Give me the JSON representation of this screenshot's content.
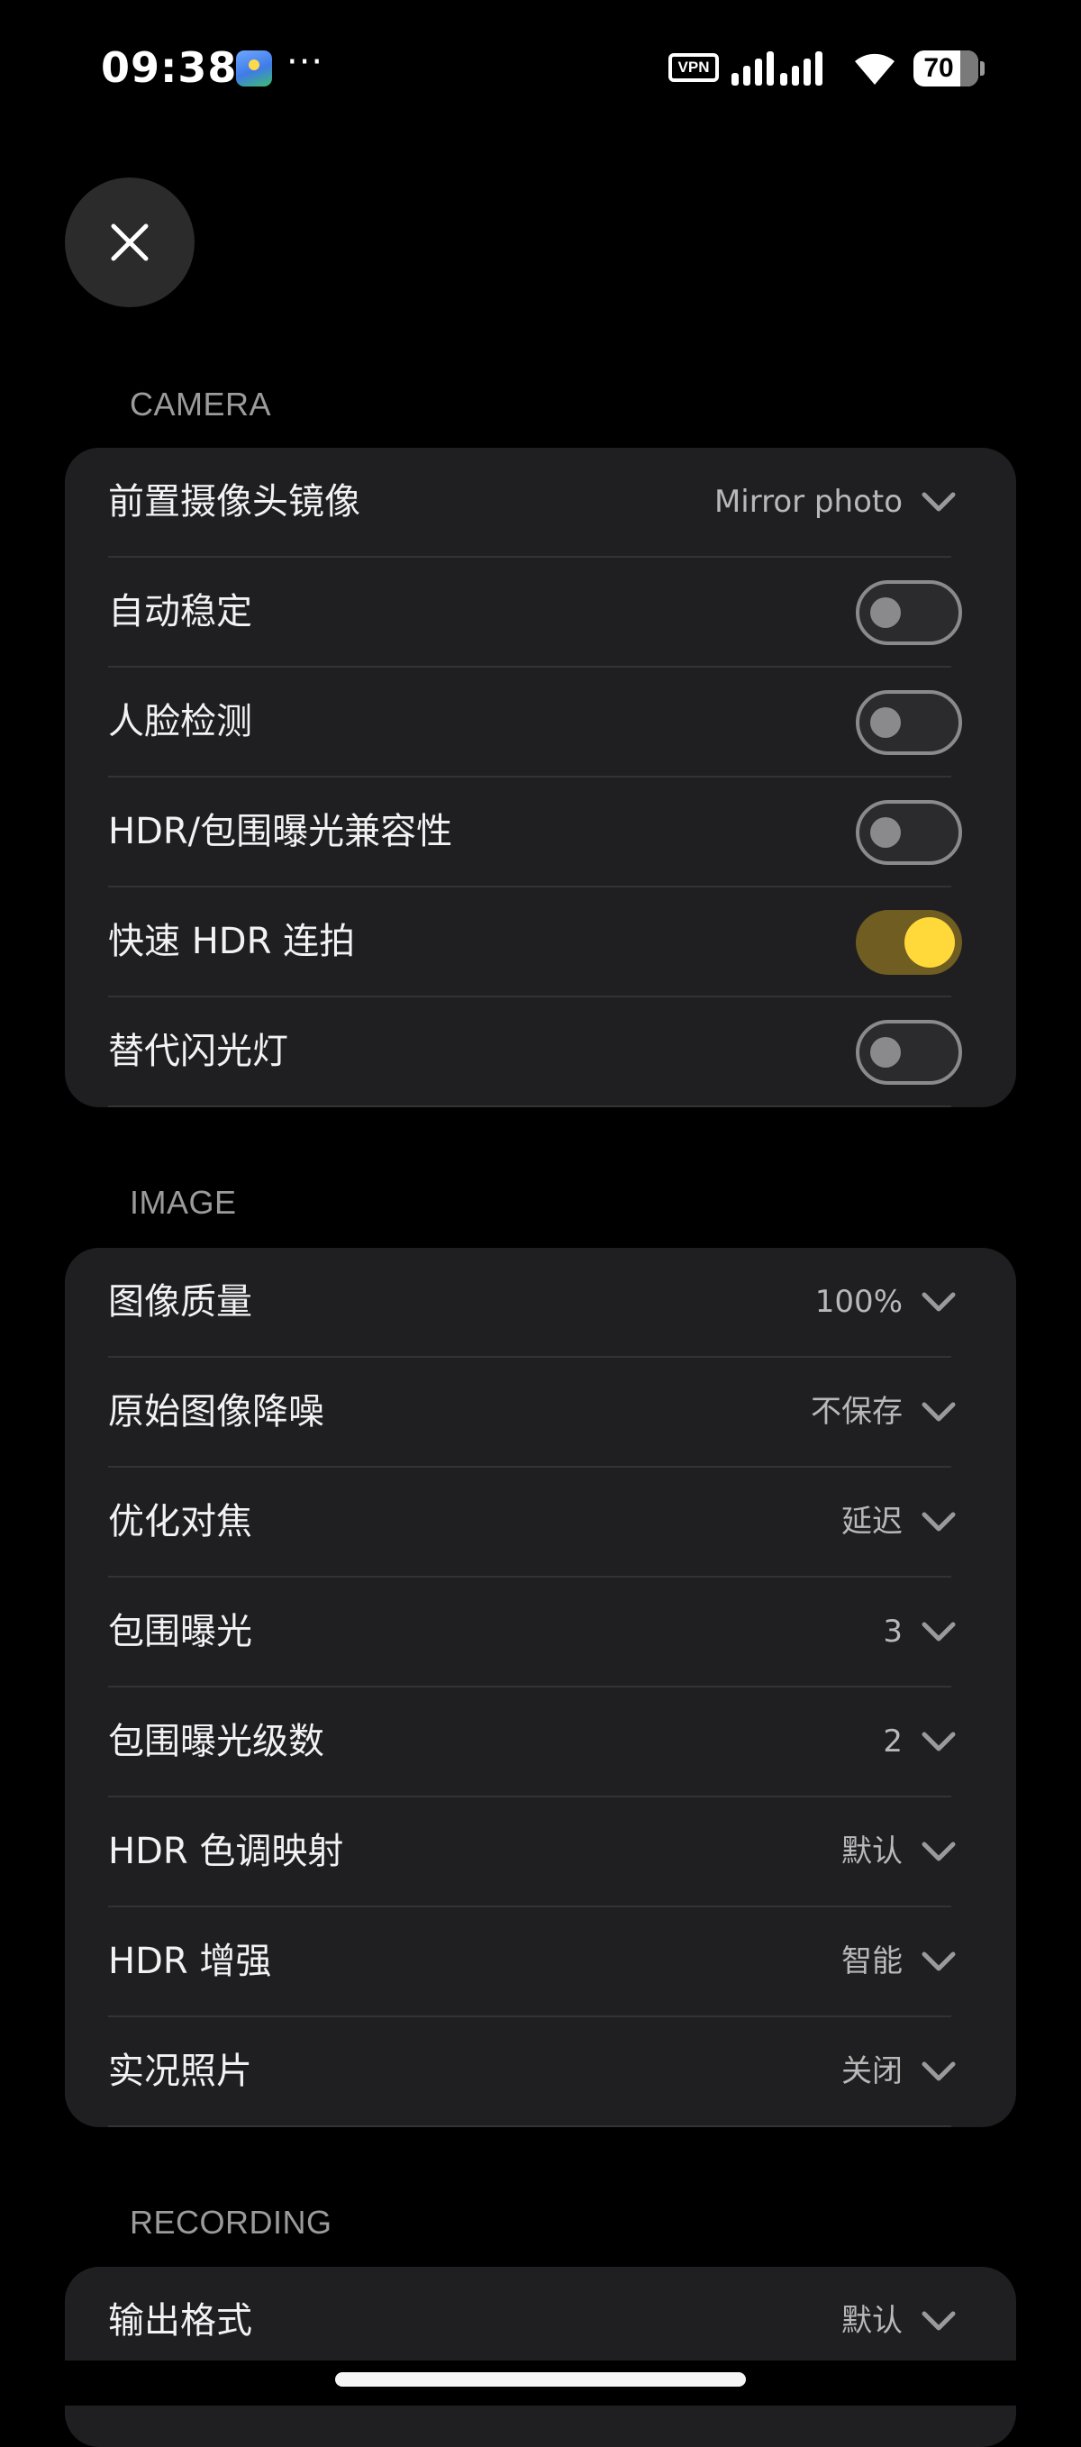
{
  "status_bar": {
    "time": "09:38",
    "more": "···",
    "vpn": "VPN",
    "battery_level": "70",
    "icons": [
      "app-notification-icon",
      "signal-icon",
      "wifi-icon",
      "battery-icon"
    ]
  },
  "close_button": {
    "icon": "close-icon"
  },
  "sections": {
    "camera": {
      "title": "CAMERA",
      "rows": [
        {
          "label": "前置摄像头镜像",
          "value": "Mirror photo",
          "type": "dropdown"
        },
        {
          "label": "自动稳定",
          "type": "toggle",
          "on": false
        },
        {
          "label": "人脸检测",
          "type": "toggle",
          "on": false
        },
        {
          "label": "HDR/包围曝光兼容性",
          "type": "toggle",
          "on": false
        },
        {
          "label": "快速 HDR 连拍",
          "type": "toggle",
          "on": true
        },
        {
          "label": "替代闪光灯",
          "type": "toggle",
          "on": false
        }
      ]
    },
    "image": {
      "title": "IMAGE",
      "rows": [
        {
          "label": "图像质量",
          "value": "100%",
          "type": "dropdown"
        },
        {
          "label": "原始图像降噪",
          "value": "不保存",
          "type": "dropdown"
        },
        {
          "label": "优化对焦",
          "value": "延迟",
          "type": "dropdown"
        },
        {
          "label": "包围曝光",
          "value": "3",
          "type": "dropdown"
        },
        {
          "label": "包围曝光级数",
          "value": "2",
          "type": "dropdown"
        },
        {
          "label": "HDR 色调映射",
          "value": "默认",
          "type": "dropdown"
        },
        {
          "label": "HDR 增强",
          "value": "智能",
          "type": "dropdown"
        },
        {
          "label": "实况照片",
          "value": "关闭",
          "type": "dropdown"
        }
      ]
    },
    "recording": {
      "title": "RECORDING",
      "rows": [
        {
          "label": "输出格式",
          "value": "默认",
          "type": "dropdown"
        }
      ]
    }
  },
  "colors": {
    "background": "#000000",
    "card": "#1f1f21",
    "toggle_on_track": "#6f5d22",
    "toggle_on_knob": "#ffd83a",
    "toggle_off_border": "#8a8a8c",
    "section_title": "#9b9b9b"
  }
}
